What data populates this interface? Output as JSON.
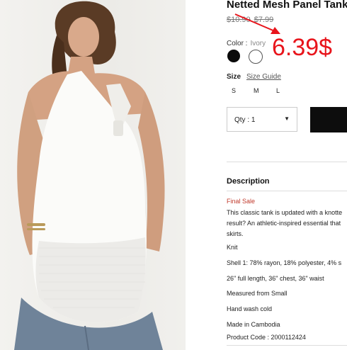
{
  "product": {
    "title": "Netted Mesh Panel Tank",
    "original_price": "$10.90",
    "sale_price": "$7.99",
    "annotated_price": "6.39$",
    "annotation_color": "#e8141b"
  },
  "color": {
    "label": "Color :",
    "selected": "Ivory",
    "swatches": [
      {
        "name": "black",
        "hex": "#0a0a0a"
      },
      {
        "name": "ivory",
        "hex": "#ffffff"
      }
    ]
  },
  "size": {
    "label": "Size",
    "guide_label": "Size Guide",
    "options": [
      "S",
      "M",
      "L"
    ]
  },
  "quantity": {
    "label": "Qty : 1"
  },
  "description": {
    "heading": "Description",
    "final_sale": "Final Sale",
    "body_lines": [
      "This classic tank is updated with a knotte",
      "result? An athletic-inspired essential that",
      "skirts."
    ],
    "details": [
      "Knit",
      "Shell 1: 78% rayon, 18% polyester, 4% s",
      "26\" full length, 36\" chest, 36\" waist",
      "Measured from Small",
      "Hand wash cold",
      "Made in Cambodia",
      "Product Code : 2000112424"
    ]
  }
}
